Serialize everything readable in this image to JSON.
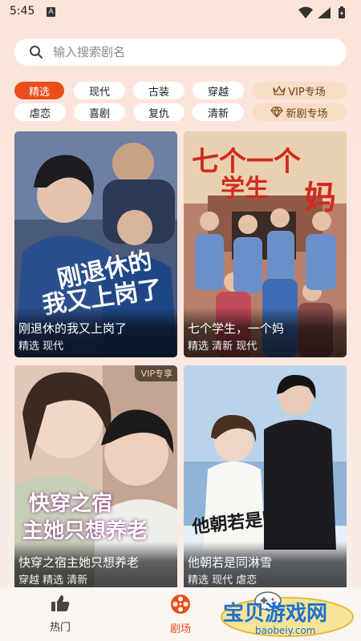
{
  "status_bar": {
    "time": "5:45",
    "notification_letter": "A"
  },
  "search": {
    "placeholder": "输入搜索剧名",
    "value": ""
  },
  "filters": {
    "row1": [
      "精选",
      "现代",
      "古装",
      "穿越"
    ],
    "row2": [
      "虐恋",
      "喜剧",
      "复仇",
      "清新"
    ],
    "vip_label": "VIP专场",
    "new_label": "新剧专场",
    "active": "精选"
  },
  "dramas": [
    {
      "title": "刚退休的我又上岗了",
      "tags": "精选 现代",
      "poster_text": [
        "刚退休的",
        "我又上岗了"
      ],
      "badge": ""
    },
    {
      "title": "七个学生，一个妈",
      "tags": "精选 清新 现代",
      "poster_text": [
        "七个一个",
        "学生",
        "妈"
      ],
      "badge": ""
    },
    {
      "title": "快穿之宿主她只想养老",
      "tags": "穿越 精选 清新",
      "poster_text": [
        "快穿之宿",
        "主她只想养老"
      ],
      "badge": "VIP专享"
    },
    {
      "title": "他朝若是同淋雪",
      "tags": "精选 现代 虐恋",
      "poster_text": [
        "他朝若是同淋雪"
      ],
      "badge": ""
    }
  ],
  "bottom_nav": {
    "hot": "热门",
    "theater": "剧场",
    "active": "剧场"
  },
  "watermark": {
    "text": "宝贝游戏网",
    "url": "baobeiy.com"
  },
  "colors": {
    "accent": "#e94e1b",
    "vip_chip": "#f7ddc5",
    "background": "#fbe3d8"
  }
}
